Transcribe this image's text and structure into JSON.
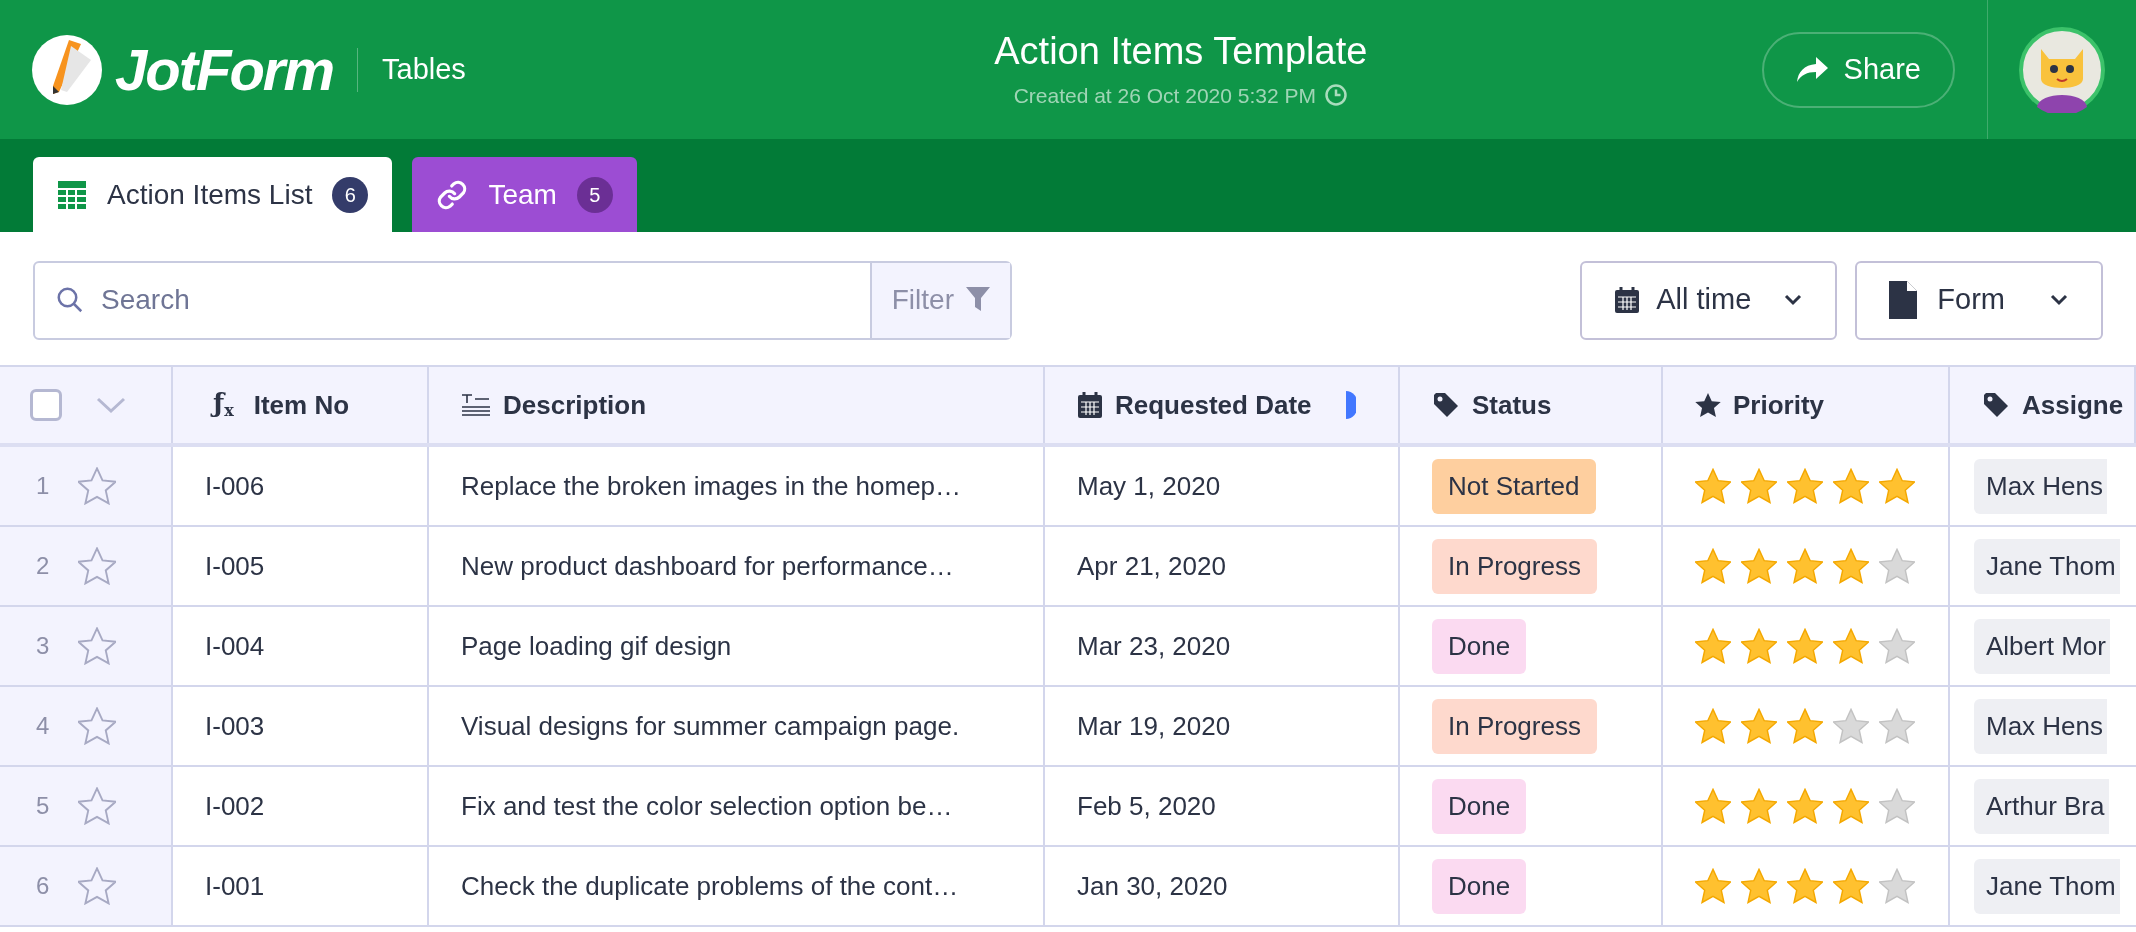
{
  "header": {
    "logo": "JotForm",
    "section": "Tables",
    "title": "Action Items Template",
    "subtitle": "Created at 26 Oct 2020 5:32 PM",
    "share": "Share"
  },
  "tabs": [
    {
      "label": "Action Items List",
      "count": "6",
      "selected": true
    },
    {
      "label": "Team",
      "count": "5",
      "selected": false
    }
  ],
  "toolbar": {
    "search": {
      "placeholder": "Search"
    },
    "filter": "Filter",
    "date_range": "All time",
    "view": "Form"
  },
  "table": {
    "select_all": {
      "checked": false
    },
    "columns": [
      {
        "label": "Item No",
        "kind": "formula",
        "icon": "ƒ$_{x}$"
      },
      {
        "label": "Description",
        "kind": "text"
      },
      {
        "label": "Requested Date",
        "kind": "date"
      },
      {
        "label": "Status",
        "kind": "tag"
      },
      {
        "label": "Priority",
        "kind": "rating"
      },
      {
        "label": "Assigne",
        "kind": "tag"
      }
    ],
    "rows": [
      {
        "number": "1",
        "starred": false,
        "item_no": "I-006",
        "description": "Replace the broken images in the homep…",
        "date": "May 1, 2020",
        "status": {
          "text": "Not Started",
          "color": "#fecf9f"
        },
        "priority": {
          "stars": 5
        },
        "assigned": "Max Hens"
      },
      {
        "number": "2",
        "starred": false,
        "item_no": "I-005",
        "description": "New product dashboard for performance…",
        "date": "Apr 21, 2020",
        "status": {
          "text": "In Progress",
          "color": "#fed9cd"
        },
        "priority": {
          "stars": 4
        },
        "assigned": "Jane Thom"
      },
      {
        "number": "3",
        "starred": false,
        "item_no": "I-004",
        "description": "Page loading gif design",
        "date": "Mar 23, 2020",
        "status": {
          "text": "Done",
          "color": "#fbdaf1"
        },
        "priority": {
          "stars": 4
        },
        "assigned": "Albert Mor"
      },
      {
        "number": "4",
        "starred": false,
        "item_no": "I-003",
        "description": "Visual designs for summer campaign page.",
        "date": "Mar 19, 2020",
        "status": {
          "text": "In Progress",
          "color": "#fed9cd"
        },
        "priority": {
          "stars": 3
        },
        "assigned": "Max Hens"
      },
      {
        "number": "5",
        "starred": false,
        "item_no": "I-002",
        "description": "Fix and test the color selection option be…",
        "date": "Feb 5, 2020",
        "status": {
          "text": "Done",
          "color": "#fbdaf1"
        },
        "priority": {
          "stars": 4
        },
        "assigned": "Arthur Bra"
      },
      {
        "number": "6",
        "starred": false,
        "item_no": "I-001",
        "description": "Check the duplicate problems of the cont…",
        "date": "Jan 30, 2020",
        "status": {
          "text": "Done",
          "color": "#fbdaf1"
        },
        "priority": {
          "stars": 4
        },
        "assigned": "Jane Thom"
      }
    ]
  }
}
